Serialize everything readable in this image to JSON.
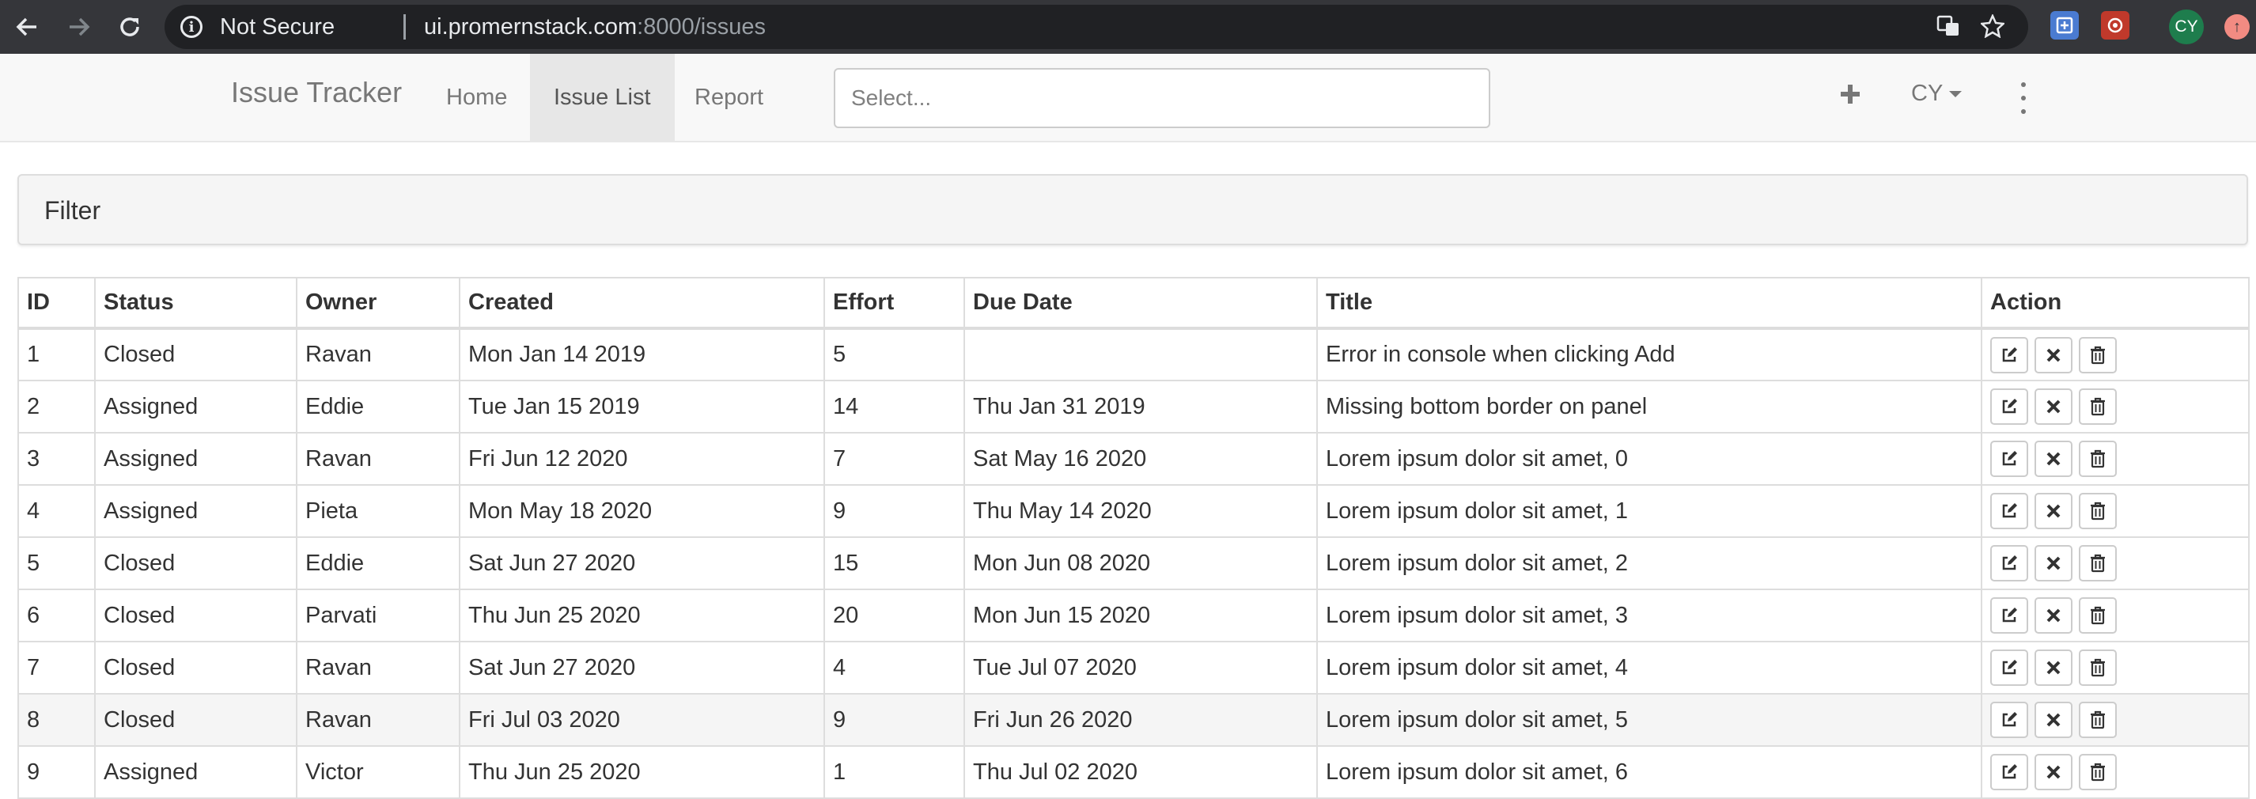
{
  "browser": {
    "security_label": "Not Secure",
    "url_host": "ui.promernstack.com",
    "url_path": ":8000/issues",
    "profile_initials": "CY"
  },
  "navbar": {
    "brand": "Issue Tracker",
    "links": [
      "Home",
      "Issue List",
      "Report"
    ],
    "active_link": "Issue List",
    "select_placeholder": "Select...",
    "user_menu": "CY"
  },
  "filter": {
    "title": "Filter"
  },
  "table": {
    "headers": [
      "ID",
      "Status",
      "Owner",
      "Created",
      "Effort",
      "Due Date",
      "Title",
      "Action"
    ],
    "rows": [
      [
        "1",
        "Closed",
        "Ravan",
        "Mon Jan 14 2019",
        "5",
        "",
        "Error in console when clicking Add"
      ],
      [
        "2",
        "Assigned",
        "Eddie",
        "Tue Jan 15 2019",
        "14",
        "Thu Jan 31 2019",
        "Missing bottom border on panel"
      ],
      [
        "3",
        "Assigned",
        "Ravan",
        "Fri Jun 12 2020",
        "7",
        "Sat May 16 2020",
        "Lorem ipsum dolor sit amet, 0"
      ],
      [
        "4",
        "Assigned",
        "Pieta",
        "Mon May 18 2020",
        "9",
        "Thu May 14 2020",
        "Lorem ipsum dolor sit amet, 1"
      ],
      [
        "5",
        "Closed",
        "Eddie",
        "Sat Jun 27 2020",
        "15",
        "Mon Jun 08 2020",
        "Lorem ipsum dolor sit amet, 2"
      ],
      [
        "6",
        "Closed",
        "Parvati",
        "Thu Jun 25 2020",
        "20",
        "Mon Jun 15 2020",
        "Lorem ipsum dolor sit amet, 3"
      ],
      [
        "7",
        "Closed",
        "Ravan",
        "Sat Jun 27 2020",
        "4",
        "Tue Jul 07 2020",
        "Lorem ipsum dolor sit amet, 4"
      ],
      [
        "8",
        "Closed",
        "Ravan",
        "Fri Jul 03 2020",
        "9",
        "Fri Jun 26 2020",
        "Lorem ipsum dolor sit amet, 5"
      ],
      [
        "9",
        "Assigned",
        "Victor",
        "Thu Jun 25 2020",
        "1",
        "Thu Jul 02 2020",
        "Lorem ipsum dolor sit amet, 6"
      ]
    ],
    "highlighted_row": 7,
    "action_icons": [
      "edit-icon",
      "close-icon",
      "trash-icon"
    ]
  }
}
